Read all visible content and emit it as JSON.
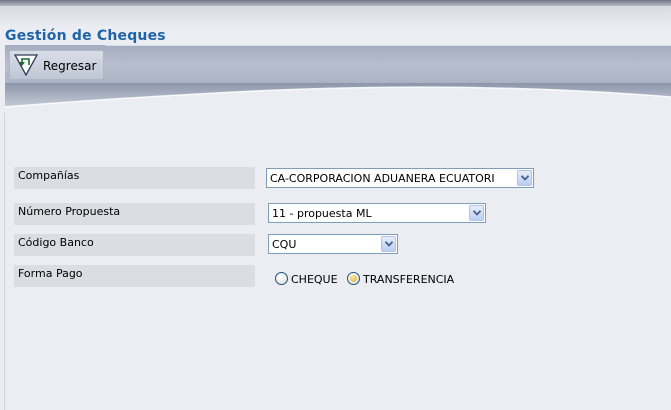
{
  "page": {
    "title": "Gestión de Cheques"
  },
  "toolbar": {
    "back_label": "Regresar"
  },
  "form": {
    "companias": {
      "label": "Compañías",
      "value": "CA-CORPORACION ADUANERA ECUATORI"
    },
    "propuesta": {
      "label": "Número Propuesta",
      "value": "11 - propuesta ML"
    },
    "banco": {
      "label": "Código Banco",
      "value": "CQU"
    },
    "forma_pago": {
      "label": "Forma Pago",
      "options": [
        {
          "label": "CHEQUE",
          "checked": false
        },
        {
          "label": "TRANSFERENCIA",
          "checked": true
        }
      ]
    }
  },
  "icons": {
    "back": "return-arrow-icon",
    "dropdown": "chevron-down-icon"
  },
  "colors": {
    "title": "#1f64a8",
    "toolbar": "#b8c0cf",
    "background": "#ecedf2",
    "label_bg": "#dcdde3"
  }
}
